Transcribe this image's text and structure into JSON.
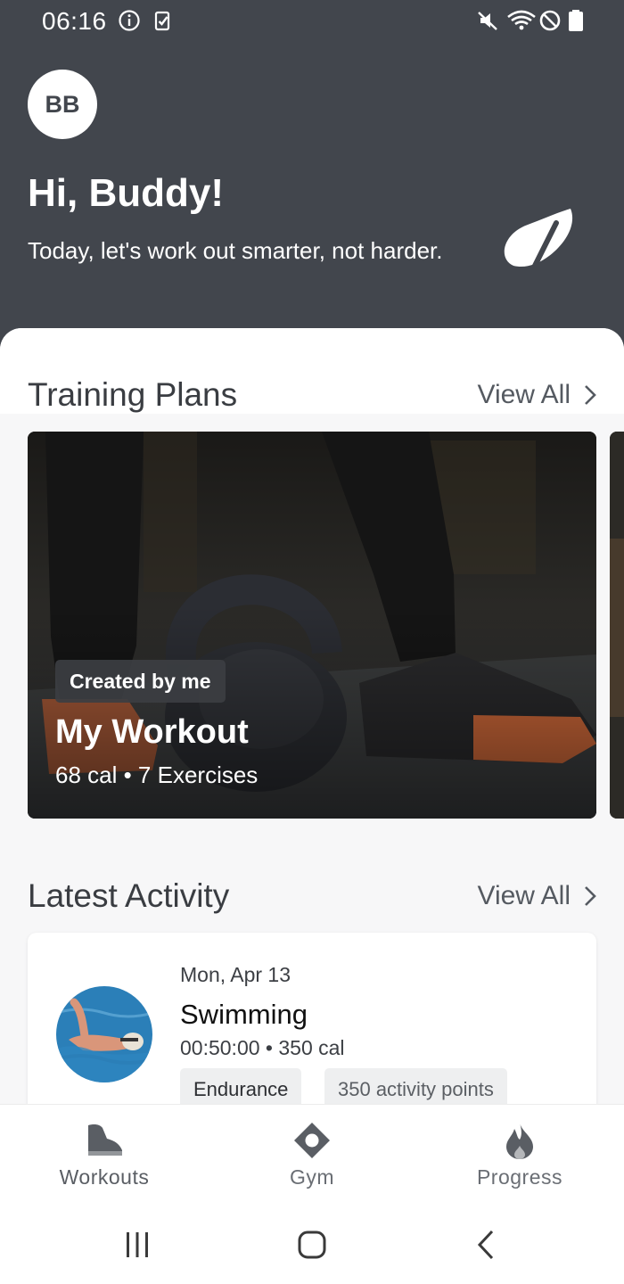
{
  "status_bar": {
    "time": "06:16",
    "left_icons": [
      "info-icon",
      "clipboard-check-icon"
    ],
    "right_icons": [
      "mute-icon",
      "wifi-icon",
      "do-not-disturb-icon",
      "battery-icon"
    ]
  },
  "header": {
    "avatar_initials": "BB",
    "greeting": "Hi, Buddy!",
    "tagline": "Today, let's work out smarter, not harder.",
    "logo_icon": "brand-leaf-logo",
    "background": "#42464d"
  },
  "training_plans": {
    "title": "Training Plans",
    "view_all": "View All",
    "cards": [
      {
        "badge": "Created by me",
        "title": "My Workout",
        "meta": "68 cal • 7 Exercises",
        "image": "kettlebell-workout-photo"
      }
    ]
  },
  "latest_activity": {
    "title": "Latest Activity",
    "view_all": "View All",
    "items": [
      {
        "date": "Mon, Apr 13",
        "title": "Swimming",
        "meta": "00:50:00 • 350 cal",
        "tags": [
          "Endurance",
          "350 activity points"
        ],
        "image": "swimmer-photo"
      }
    ]
  },
  "bottom_nav": {
    "items": [
      {
        "label": "Workouts",
        "icon": "shoe-icon"
      },
      {
        "label": "Gym",
        "icon": "location-pin-icon"
      },
      {
        "label": "Progress",
        "icon": "flame-icon"
      }
    ],
    "label_color": "#5a5e64"
  },
  "system_nav": {
    "buttons": [
      "recents-icon",
      "home-icon",
      "back-icon"
    ]
  }
}
